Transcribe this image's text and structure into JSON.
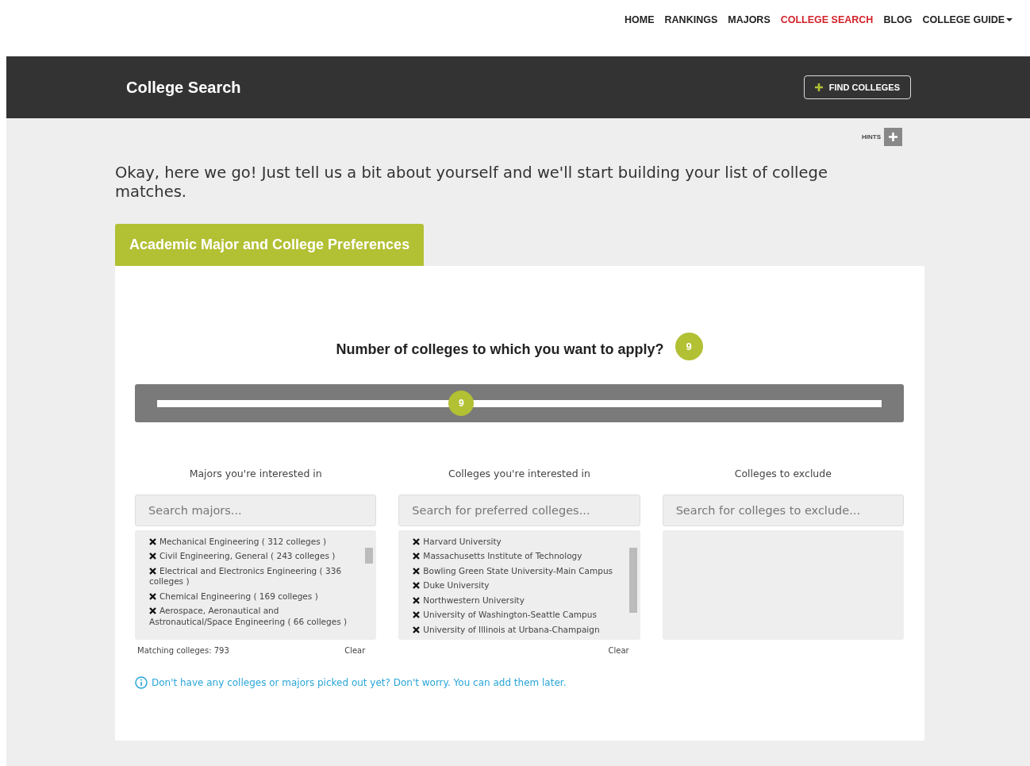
{
  "nav": [
    {
      "label": "HOME",
      "selected": false
    },
    {
      "label": "RANKINGS",
      "selected": false
    },
    {
      "label": "MAJORS",
      "selected": false
    },
    {
      "label": "COLLEGE SEARCH",
      "selected": true
    },
    {
      "label": "BLOG",
      "selected": false
    },
    {
      "label": "COLLEGE GUIDE",
      "selected": false,
      "dropdown": true
    }
  ],
  "header": {
    "title": "College Search",
    "button": "FIND COLLEGES"
  },
  "hints": "HINTS",
  "intro": "Okay, here we go! Just tell us a bit about yourself and we'll start building your list of college matches.",
  "section_tab": "Academic Major and College Preferences",
  "question": {
    "text": "Number of colleges to which you want to apply?",
    "badge": "9"
  },
  "slider": {
    "level": 0.42,
    "thumb": "9"
  },
  "columns": [
    {
      "label": "Majors you're interested in",
      "placeholder": "Search majors...",
      "items": [
        "Mechanical Engineering ( 312 colleges )",
        "Civil Engineering, General ( 243 colleges )",
        "Electrical and Electronics Engineering ( 336 colleges )",
        "Chemical Engineering ( 169 colleges )",
        "Aerospace, Aeronautical and Astronautical/Space Engineering ( 66 colleges )"
      ],
      "footer_left": "Matching colleges: 793",
      "footer_right": "Clear"
    },
    {
      "label": "Colleges you're interested in",
      "placeholder": "Search for preferred colleges...",
      "items": [
        "Harvard University",
        "Massachusetts Institute of Technology",
        "Bowling Green State University-Main Campus",
        "Duke University",
        "Northwestern University",
        "University of Washington-Seattle Campus",
        "University of Illinois at Urbana-Champaign"
      ],
      "footer_right": "Clear"
    },
    {
      "label": "Colleges to exclude",
      "placeholder": "Search for colleges to exclude..."
    }
  ],
  "note": "Don't have any colleges or majors picked out yet? Don't worry. You can add them later."
}
